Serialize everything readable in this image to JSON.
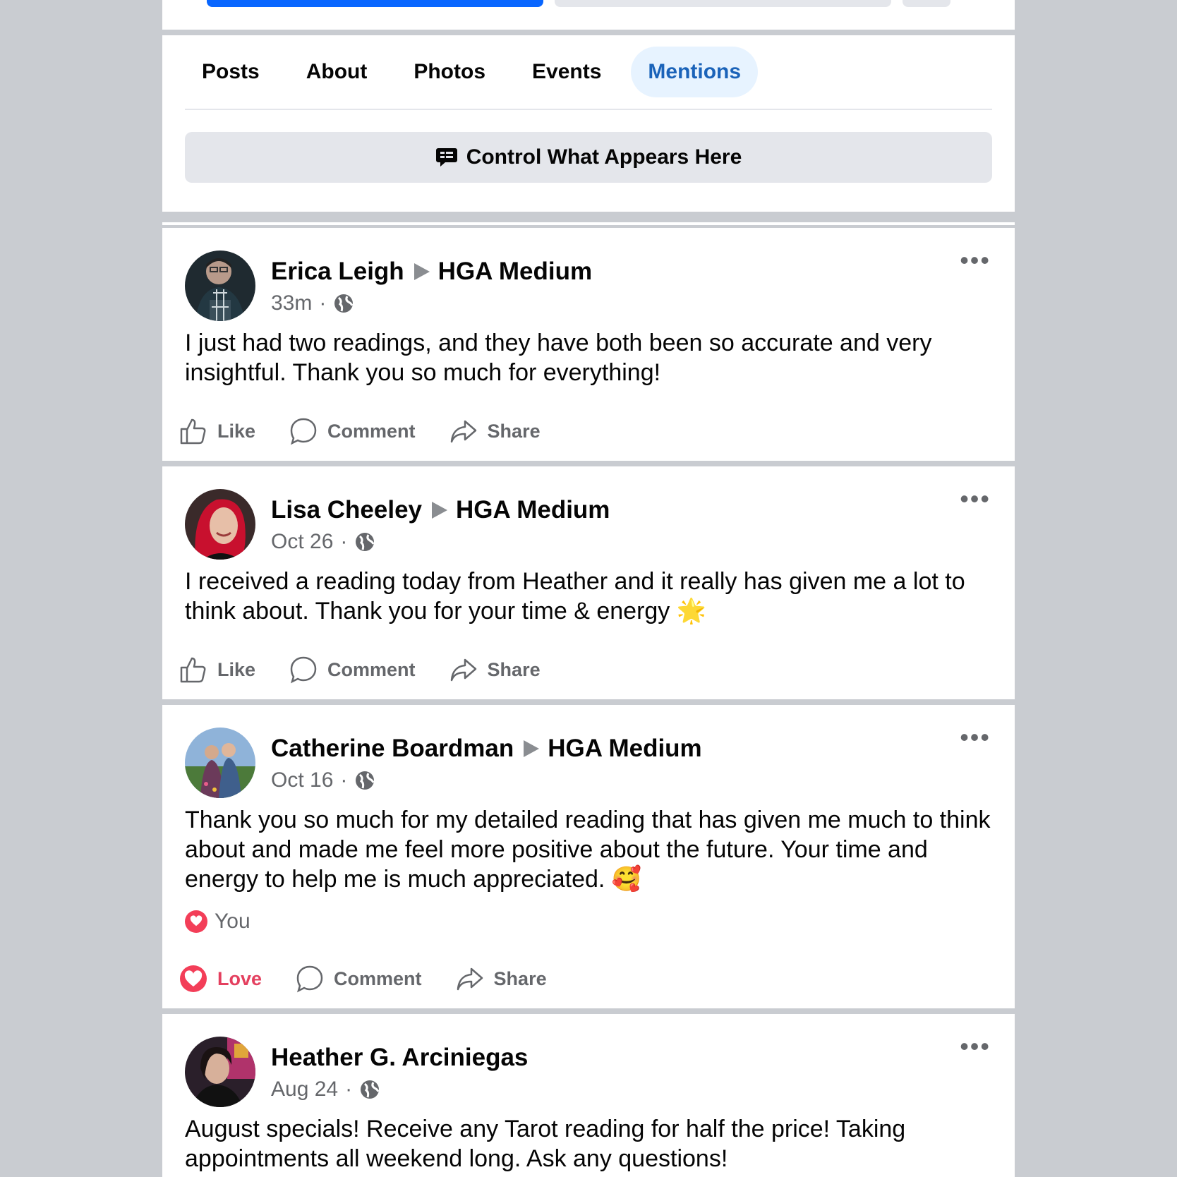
{
  "tabs": [
    {
      "label": "Posts",
      "active": false
    },
    {
      "label": "About",
      "active": false
    },
    {
      "label": "Photos",
      "active": false
    },
    {
      "label": "Events",
      "active": false
    },
    {
      "label": "Mentions",
      "active": true
    }
  ],
  "control_button": {
    "label": "Control What Appears Here",
    "icon": "chat-bubble-icon"
  },
  "posts": [
    {
      "author": "Erica Leigh",
      "target": "HGA Medium",
      "time": "33m",
      "separator": "·",
      "privacy_icon": "globe-icon",
      "text": "I just had two readings, and they have both been so accurate and very insightful. Thank you so much for everything!",
      "actions": {
        "like": "Like",
        "comment": "Comment",
        "share": "Share"
      }
    },
    {
      "author": "Lisa Cheeley",
      "target": "HGA Medium",
      "time": "Oct 26",
      "separator": "·",
      "privacy_icon": "globe-icon",
      "text": "I received a reading today from Heather and it really has given me a lot to think about. Thank you for your time & energy 🌟",
      "actions": {
        "like": "Like",
        "comment": "Comment",
        "share": "Share"
      }
    },
    {
      "author": "Catherine Boardman",
      "target": "HGA Medium",
      "time": "Oct 16",
      "separator": "·",
      "privacy_icon": "globe-icon",
      "text": "Thank you so much for my detailed reading that has given me much to think about and made me feel more positive about the future. Your time and energy to help me is much appreciated. 🥰",
      "reaction_summary": "You",
      "actions": {
        "like": "Love",
        "comment": "Comment",
        "share": "Share"
      }
    },
    {
      "author": "Heather G. Arciniegas",
      "time": "Aug 24",
      "separator": "·",
      "privacy_icon": "globe-icon",
      "text": "August specials! Receive any Tarot reading for half the price! Taking appointments all weekend long. Ask any questions!"
    }
  ],
  "colors": {
    "accent": "#1b63b9",
    "primary_button": "#0866ff",
    "love": "#e4405f",
    "background": "#c9ccd1"
  }
}
